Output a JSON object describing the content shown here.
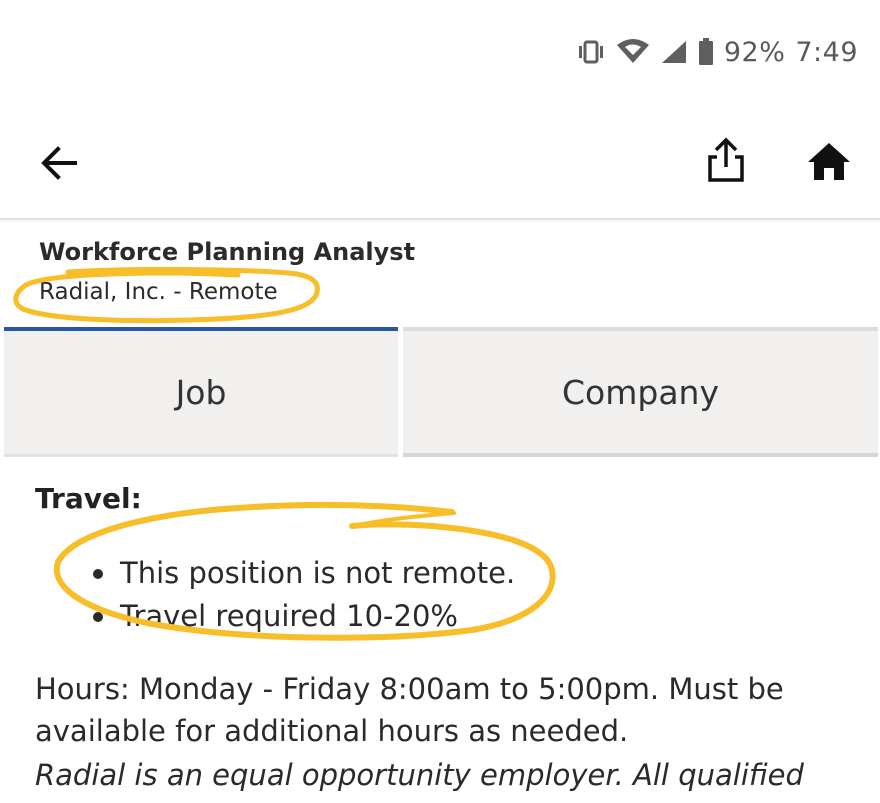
{
  "status_bar": {
    "battery": "92%",
    "time": "7:49",
    "icons": [
      "vibrate-icon",
      "wifi-icon",
      "signal-icon",
      "battery-icon"
    ]
  },
  "app_bar": {
    "icons": [
      "back-arrow-icon",
      "share-icon",
      "home-icon"
    ]
  },
  "job": {
    "title": "Workforce Planning Analyst",
    "company_location": "Radial, Inc. - Remote"
  },
  "tabs": [
    {
      "label": "Job",
      "selected": true
    },
    {
      "label": "Company",
      "selected": false
    }
  ],
  "description": {
    "travel_heading": "Travel:",
    "travel_bullets": [
      "This position is not remote.",
      "Travel required 10-20%"
    ],
    "hours_text": "Hours: Monday - Friday 8:00am to 5:00pm. Must be available for additional hours as needed.",
    "eeo_text": "Radial is an equal opportunity employer. All qualified"
  },
  "colors": {
    "accent": "#2a56a5",
    "highlight": "#f7be2a",
    "tab_background": "#f1f0ef"
  }
}
